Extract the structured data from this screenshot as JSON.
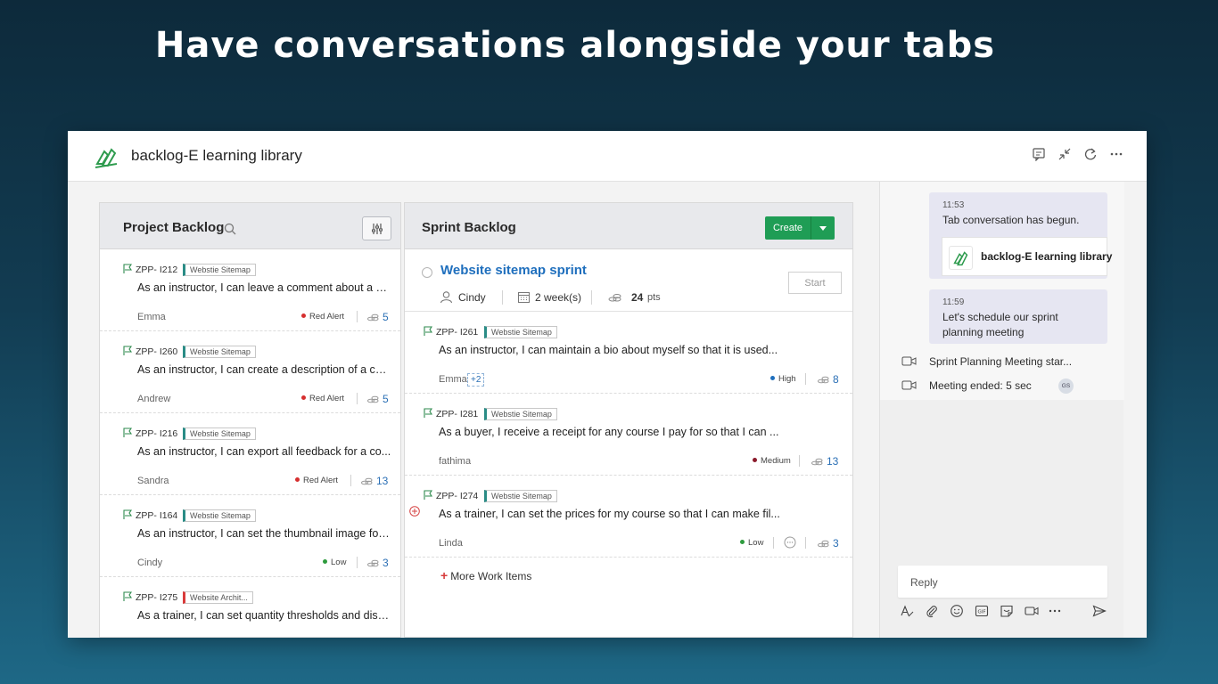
{
  "headline": "Have conversations alongside your tabs",
  "app": {
    "title": "backlog-E learning library",
    "toolbar_icons": [
      "chat-icon",
      "collapse-icon",
      "refresh-icon",
      "more-icon"
    ]
  },
  "project_backlog": {
    "title": "Project Backlog",
    "items": [
      {
        "id": "ZPP- I212",
        "tag": "Webstie Sitemap",
        "text": "As an instructor, I can leave a comment about a sa...",
        "owner": "Emma",
        "priority": "Red Alert",
        "priority_color": "#d62f2f",
        "points": "5"
      },
      {
        "id": "ZPP- I260",
        "tag": "Webstie Sitemap",
        "text": "As an instructor, I can create a description of a cou...",
        "owner": "Andrew",
        "priority": "Red Alert",
        "priority_color": "#d62f2f",
        "points": "5"
      },
      {
        "id": "ZPP- I216",
        "tag": "Webstie Sitemap",
        "text": "As an instructor, I can export all feedback for a co...",
        "owner": "Sandra",
        "priority": "Red Alert",
        "priority_color": "#d62f2f",
        "points": "13"
      },
      {
        "id": "ZPP- I164",
        "tag": "Webstie Sitemap",
        "text": "As an instructor, I can set the thumbnail image for ...",
        "owner": "Cindy",
        "priority": "Low",
        "priority_color": "#2e9b3e",
        "points": "3"
      },
      {
        "id": "ZPP- I275",
        "tag": "Website Archit...",
        "text": "As a trainer, I can set quantity thresholds and disc..."
      }
    ]
  },
  "sprint_backlog": {
    "title": "Sprint Backlog",
    "create_label": "Create",
    "sprint": {
      "name": "Website sitemap sprint",
      "owner": "Cindy",
      "duration": "2 week(s)",
      "points": "24",
      "points_unit": "pts",
      "start_label": "Start"
    },
    "items": [
      {
        "id": "ZPP- I261",
        "tag": "Webstie Sitemap",
        "text": "As an instructor, I can maintain a bio about myself so that it is used...",
        "owner": "Emma",
        "extra": "+2",
        "priority": "High",
        "priority_color": "#1f6fbd",
        "points": "8"
      },
      {
        "id": "ZPP- I281",
        "tag": "Webstie Sitemap",
        "text": "As a buyer, I receive a receipt for any course I pay for so that I can ...",
        "owner": "fathima",
        "priority": "Medium",
        "priority_color": "#8b1a2b",
        "points": "13"
      },
      {
        "id": "ZPP- I274",
        "tag": "Webstie Sitemap",
        "text": "As a trainer, I can set the prices for my course so that I can make fil...",
        "owner": "Linda",
        "priority": "Low",
        "priority_color": "#2e9b3e",
        "points": "3"
      }
    ],
    "more_label": "More Work Items"
  },
  "chat": {
    "messages": [
      {
        "time": "11:53",
        "text": "Tab conversation has begun.",
        "card_label": "backlog-E learning library"
      },
      {
        "time": "11:59",
        "text_line1": "Let's schedule our sprint",
        "text_line2": "planning meeting"
      }
    ],
    "events": [
      {
        "text": "Sprint Planning Meeting star..."
      },
      {
        "text": "Meeting ended: 5 sec",
        "badge": "GS"
      }
    ],
    "reply_placeholder": "Reply",
    "composer_icons": [
      "format-icon",
      "attach-icon",
      "emoji-icon",
      "gif-icon",
      "sticker-icon",
      "meet-icon",
      "more-icon",
      "send-icon"
    ]
  }
}
